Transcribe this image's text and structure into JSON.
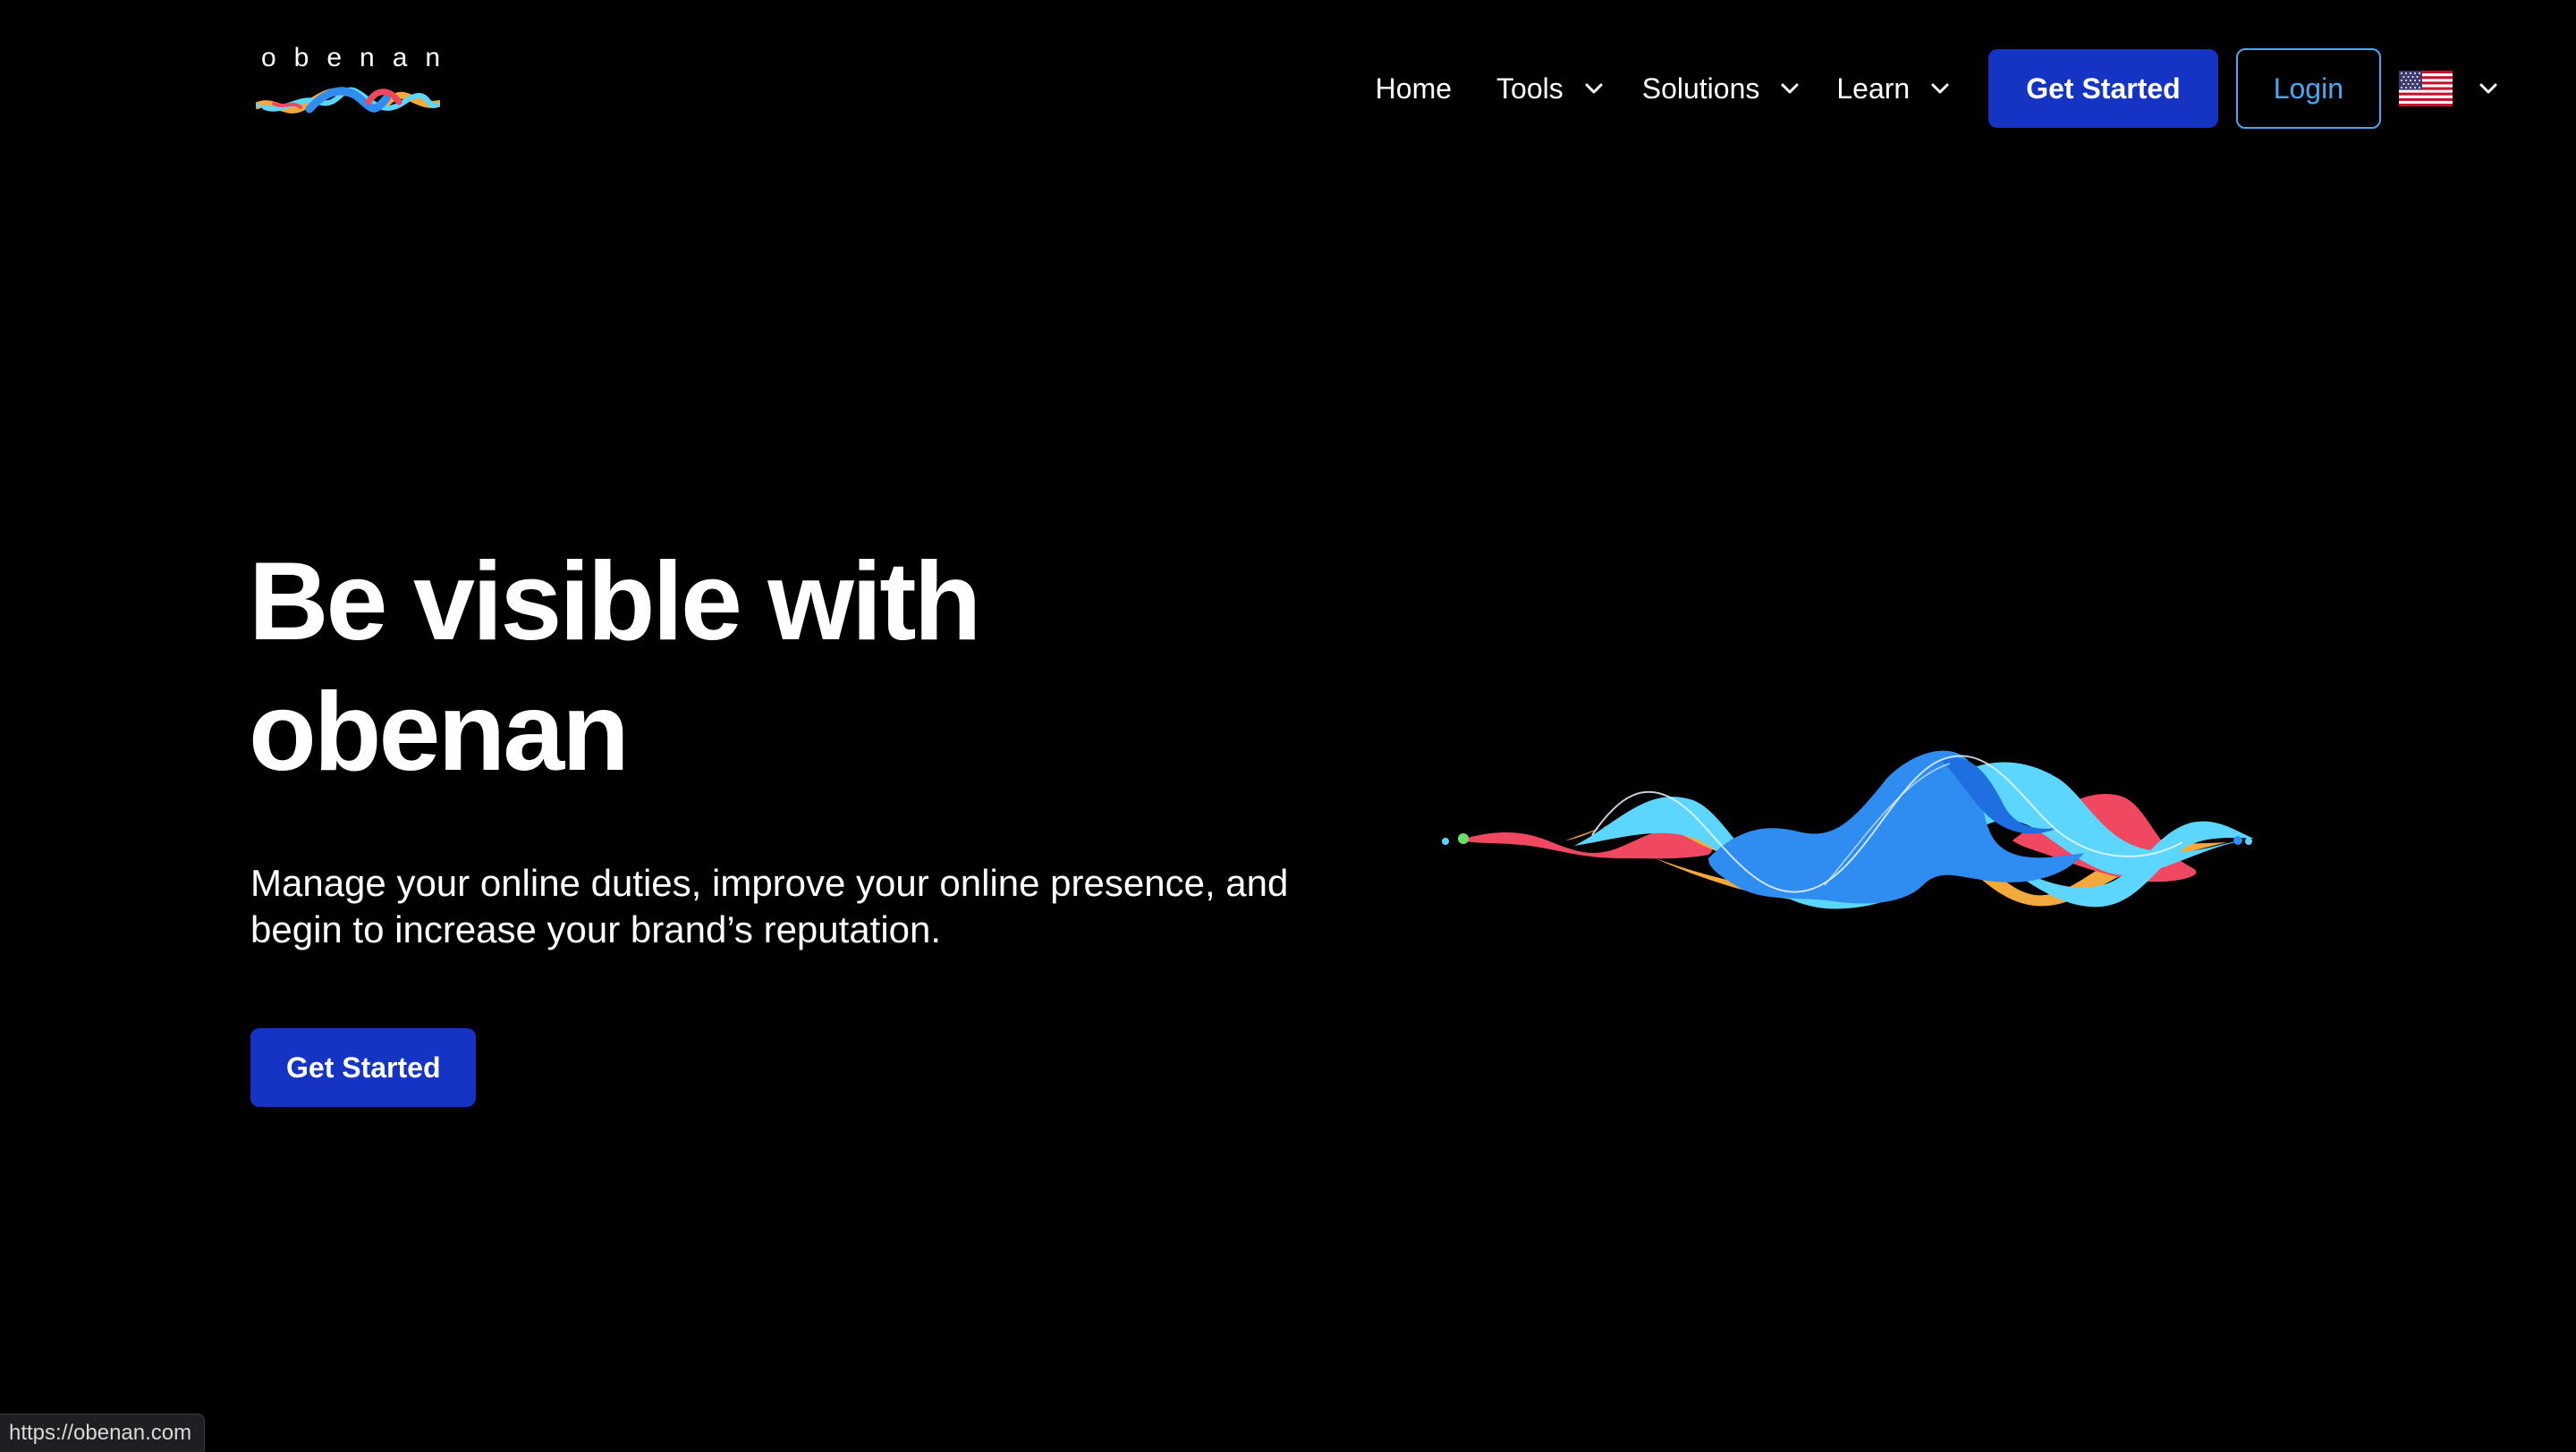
{
  "header": {
    "logo_text": "obenan",
    "nav": {
      "home": "Home",
      "tools": "Tools",
      "solutions": "Solutions",
      "learn": "Learn"
    },
    "get_started_label": "Get Started",
    "login_label": "Login",
    "language_flag": "us-flag-icon"
  },
  "hero": {
    "title": "Be visible with obenan",
    "subtitle": "Manage your online duties, improve your online presence, and begin to increase your brand’s reputation.",
    "cta_label": "Get Started"
  },
  "status_bar": {
    "url": "https://obenan.com"
  },
  "colors": {
    "background": "#000000",
    "primary_button": "#1534c4",
    "login_border": "#4aa8f0",
    "wave_blue": "#2f8cf0",
    "wave_cyan": "#5cd6ff",
    "wave_orange": "#f4a93c",
    "wave_red": "#f04860"
  }
}
